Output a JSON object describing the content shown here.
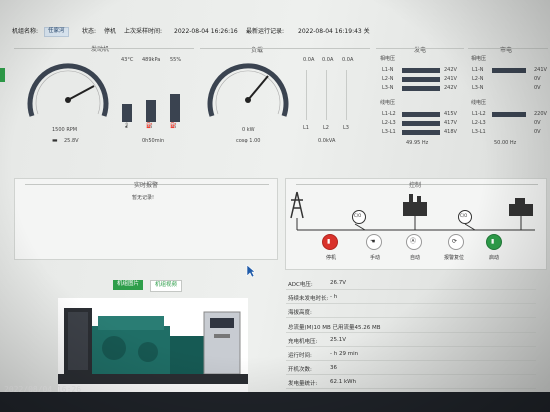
{
  "header": {
    "unit_name_label": "机组名称:",
    "unit_name": "任家河",
    "state_label": "状态:",
    "state": "停机",
    "last_sample_label": "上次采样时间:",
    "last_sample_time": "2022-08-04 16:26:16",
    "latest_run_label": "最新运行记录:",
    "latest_run_time": "2022-08-04 16:19:43 关"
  },
  "engine": {
    "title": "发动机",
    "rpm": "1500 RPM",
    "battery": "25.8V",
    "temp": "43°C",
    "oil_pressure": "489kPa",
    "fuel": "55%",
    "runtime": "0h50min"
  },
  "load": {
    "title": "负载",
    "power": "0 kW",
    "cosp": "cosφ 1.00",
    "l1": "L1",
    "l2": "L2",
    "l3": "L3",
    "l1_val": "0.0A",
    "l2_val": "0.0A",
    "l3_val": "0.0A",
    "kva": "0.0kVA"
  },
  "generator": {
    "title": "发电",
    "phase_voltage_title": "相电压",
    "line_voltage_title": "线电压",
    "freq": "49.95 Hz",
    "phase_rows": [
      {
        "label": "L1-N",
        "value": "242V"
      },
      {
        "label": "L2-N",
        "value": "241V"
      },
      {
        "label": "L3-N",
        "value": "242V"
      }
    ],
    "line_rows": [
      {
        "label": "L1-L2",
        "value": "415V"
      },
      {
        "label": "L2-L3",
        "value": "417V"
      },
      {
        "label": "L3-L1",
        "value": "418V"
      }
    ]
  },
  "mains": {
    "title": "市电",
    "phase_voltage_title": "相电压",
    "line_voltage_title": "线电压",
    "freq": "50.00 Hz",
    "phase_rows": [
      {
        "label": "L1-N",
        "value": "241V"
      },
      {
        "label": "L2-N",
        "value": "0V"
      },
      {
        "label": "L3-N",
        "value": "0V"
      }
    ],
    "line_rows": [
      {
        "label": "L1-L2",
        "value": "220V"
      },
      {
        "label": "L2-L3",
        "value": "0V"
      },
      {
        "label": "L3-L1",
        "value": "0V"
      }
    ]
  },
  "alarm": {
    "title": "实时报警",
    "empty": "暂无记录!"
  },
  "control": {
    "title": "控制",
    "co1": "C/O",
    "co2": "C/O",
    "buttons": [
      {
        "label": "停机",
        "color": "#d9322b"
      },
      {
        "label": "手动",
        "color": "#444"
      },
      {
        "label": "自动",
        "color": "#444"
      },
      {
        "label": "报警复位",
        "color": "#444"
      },
      {
        "label": "启动",
        "color": "#2e9e4a"
      }
    ]
  },
  "media": {
    "tab_image": "机组图片",
    "tab_video": "机组视频"
  },
  "info": [
    {
      "label": "ADC电压:",
      "value": "26.7V"
    },
    {
      "label": "持续未发电时长:",
      "value": "- h"
    },
    {
      "label": "海拔高度:",
      "value": ""
    },
    {
      "label": "总流量(M)10 MB 已用流量45.26 MB",
      "value": ""
    },
    {
      "label": "充电机电压:",
      "value": "25.1V"
    },
    {
      "label": "运行时间:",
      "value": "- h 29 min"
    },
    {
      "label": "开机次数:",
      "value": "36"
    },
    {
      "label": "发电量统计:",
      "value": "62.1 kWh"
    },
    {
      "label": "机油温度:",
      "value": ""
    }
  ],
  "watermark": "2022/08/04 16:26",
  "colors": {
    "accent_green": "#2e9e4a",
    "tag_blue": "#d8e4ef",
    "bar_dark": "#3a4350",
    "stop_red": "#d9322b"
  }
}
